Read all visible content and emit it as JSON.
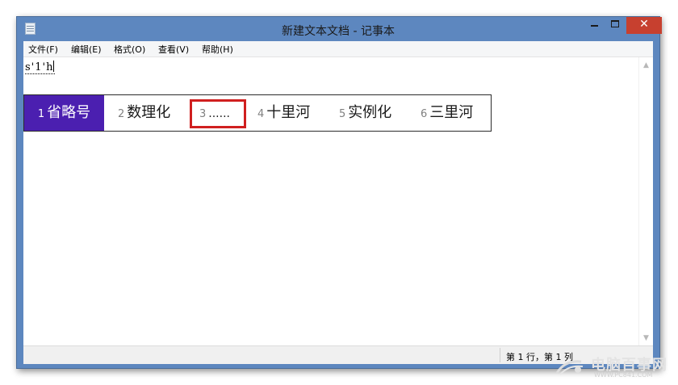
{
  "window": {
    "title": "新建文本文档 - 记事本"
  },
  "menu": {
    "items": [
      "文件(F)",
      "编辑(E)",
      "格式(O)",
      "查看(V)",
      "帮助(H)"
    ]
  },
  "editor": {
    "composition_text": "s'1'h"
  },
  "ime": {
    "candidates": [
      {
        "num": "1",
        "text": "省略号"
      },
      {
        "num": "2",
        "text": "数理化"
      },
      {
        "num": "3",
        "text": "......"
      },
      {
        "num": "4",
        "text": "十里河"
      },
      {
        "num": "5",
        "text": "实例化"
      },
      {
        "num": "6",
        "text": "三里河"
      }
    ],
    "selected_index": 0,
    "highlight_color": "#d01f1f",
    "selected_bg": "#4b1fb0"
  },
  "statusbar": {
    "position_text": "第 1 行，第 1 列"
  },
  "watermark": {
    "text": "电脑百事网",
    "sub": "WWW.PC841.COM"
  }
}
